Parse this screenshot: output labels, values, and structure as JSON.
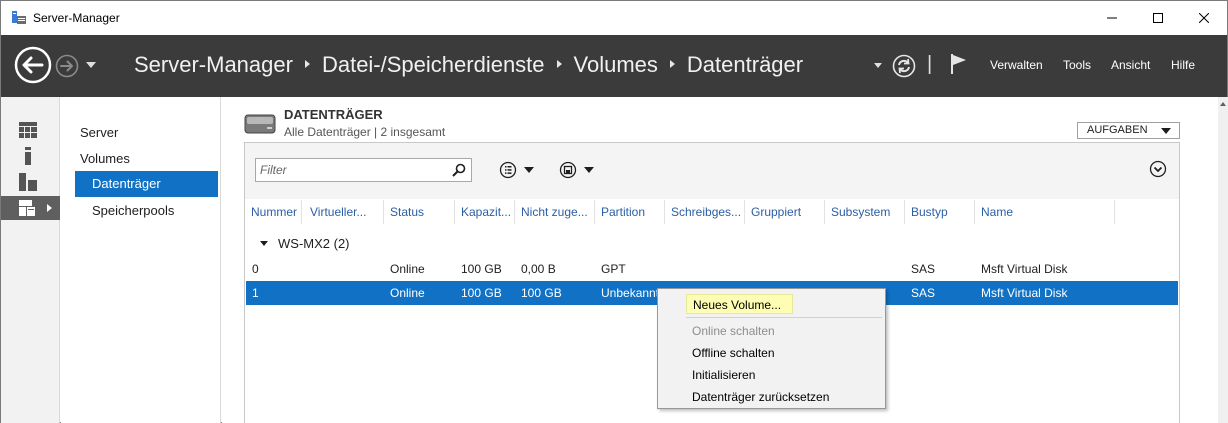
{
  "window": {
    "title": "Server-Manager"
  },
  "header": {
    "breadcrumb": [
      "Server-Manager",
      "Datei-/Speicherdienste",
      "Volumes",
      "Datenträger"
    ],
    "menu": [
      "Verwalten",
      "Tools",
      "Ansicht",
      "Hilfe"
    ],
    "pipe": "|"
  },
  "subnav": {
    "items": [
      "Server",
      "Volumes",
      "Datenträger",
      "Speicherpools"
    ],
    "active_index": 2
  },
  "section": {
    "title": "DATENTRÄGER",
    "subtitle": "Alle Datenträger | 2 insgesamt",
    "tasks_label": "AUFGABEN"
  },
  "filter": {
    "placeholder": "Filter"
  },
  "table": {
    "columns": [
      "Nummer",
      "Virtueller...",
      "Status",
      "Kapazit...",
      "Nicht zuge...",
      "Partition",
      "Schreibges...",
      "Gruppiert",
      "Subsystem",
      "Bustyp",
      "Name"
    ],
    "group_label": "WS-MX2 (2)",
    "rows": [
      {
        "nummer": "0",
        "virtuell": "",
        "status": "Online",
        "kapazitaet": "100 GB",
        "nicht_zugeordnet": "0,00 B",
        "partition": "GPT",
        "schreibgeschuetzt": "",
        "gruppiert": "",
        "subsystem": "",
        "bustyp": "SAS",
        "name": "Msft Virtual Disk"
      },
      {
        "nummer": "1",
        "virtuell": "",
        "status": "Online",
        "kapazitaet": "100 GB",
        "nicht_zugeordnet": "100 GB",
        "partition": "Unbekannt",
        "schreibgeschuetzt": "",
        "gruppiert": "",
        "subsystem": "",
        "bustyp": "SAS",
        "name": "Msft Virtual Disk"
      }
    ],
    "selected_row": 1
  },
  "context_menu": {
    "items": [
      {
        "label": "Neues Volume...",
        "state": "highlighted"
      },
      {
        "label": "Online schalten",
        "state": "disabled"
      },
      {
        "label": "Offline schalten",
        "state": "enabled"
      },
      {
        "label": "Initialisieren",
        "state": "enabled"
      },
      {
        "label": "Datenträger zurücksetzen",
        "state": "enabled"
      }
    ]
  },
  "colors": {
    "header_bg": "#3b3b3b",
    "selection": "#1071c5",
    "menu_highlight": "#fdfdb4",
    "column_header_text": "#2a5fa5"
  },
  "icons": {
    "app": "server-manager-icon",
    "back": "back-arrow-icon",
    "forward": "forward-arrow-icon",
    "refresh": "refresh-icon",
    "flag": "notification-flag-icon",
    "search": "search-icon",
    "list_view": "list-view-icon",
    "save": "save-icon",
    "collapse": "chevron-down-circle-icon"
  }
}
